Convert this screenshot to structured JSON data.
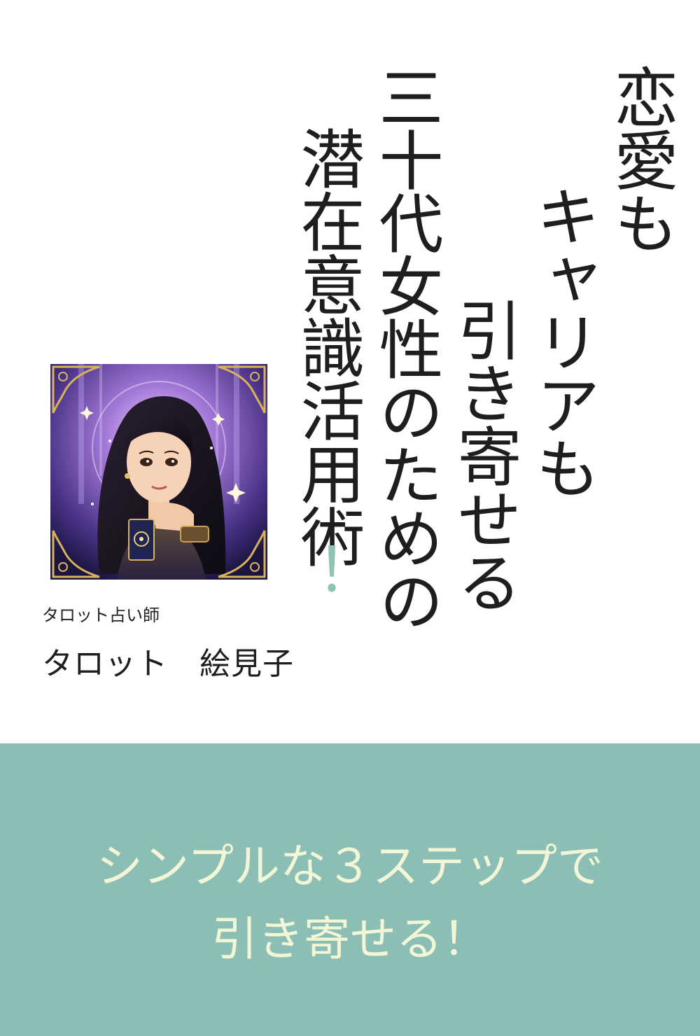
{
  "cover": {
    "title_columns": [
      "恋愛も",
      "キャリアも",
      "引き寄せる",
      "三十代女性のための",
      "潜在意識活用術"
    ],
    "title_exclamation": "！",
    "author_role": "タロット占い師",
    "author_name": "タロット　絵見子",
    "tagline_line1": "シンプルな３ステップで",
    "tagline_line2": "引き寄せる！"
  },
  "colors": {
    "band": "#8bbfb5",
    "tagline_text": "#f3f6d6",
    "accent_exclamation": "#8ec3b6",
    "title_text": "#1e1e1e"
  }
}
